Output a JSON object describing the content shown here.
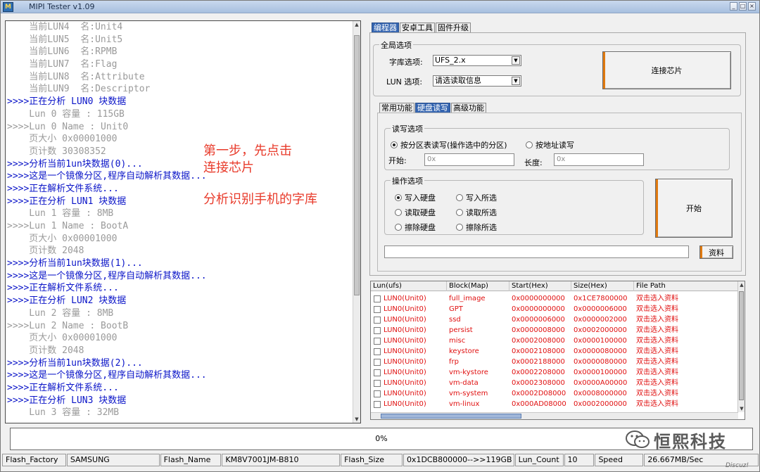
{
  "window": {
    "title": "MIPI Tester v1.09",
    "controls": {
      "minimize": "_",
      "maximize": "□",
      "close": "×"
    }
  },
  "log": [
    {
      "text": "    当前LUN4  名:Unit4",
      "color": "gray"
    },
    {
      "text": "    当前LUN5  名:Unit5",
      "color": "gray"
    },
    {
      "text": "    当前LUN6  名:RPMB",
      "color": "gray"
    },
    {
      "text": "    当前LUN7  名:Flag",
      "color": "gray"
    },
    {
      "text": "    当前LUN8  名:Attribute",
      "color": "gray"
    },
    {
      "text": "    当前LUN9  名:Descriptor",
      "color": "gray"
    },
    {
      "text": ">>>>正在分析 LUN0 块数据",
      "color": "blue"
    },
    {
      "text": "    Lun 0 容量 : 115GB",
      "color": "gray"
    },
    {
      "text": ">>>>Lun 0 Name : Unit0",
      "color": "gray"
    },
    {
      "text": "    页大小 0x00001000",
      "color": "gray"
    },
    {
      "text": "    页计数 30308352",
      "color": "gray"
    },
    {
      "text": ">>>>分析当前1un块数据(0)...",
      "color": "blue"
    },
    {
      "text": ">>>>这是一个镜像分区,程序自动解析其数据...",
      "color": "blue"
    },
    {
      "text": ">>>>正在解析文件系统...",
      "color": "blue"
    },
    {
      "text": ">>>>正在分析 LUN1 块数据",
      "color": "blue"
    },
    {
      "text": "    Lun 1 容量 : 8MB",
      "color": "gray"
    },
    {
      "text": ">>>>Lun 1 Name : BootA",
      "color": "gray"
    },
    {
      "text": "    页大小 0x00001000",
      "color": "gray"
    },
    {
      "text": "    页计数 2048",
      "color": "gray"
    },
    {
      "text": ">>>>分析当前1un块数据(1)...",
      "color": "blue"
    },
    {
      "text": ">>>>这是一个镜像分区,程序自动解析其数据...",
      "color": "blue"
    },
    {
      "text": ">>>>正在解析文件系统...",
      "color": "blue"
    },
    {
      "text": ">>>>正在分析 LUN2 块数据",
      "color": "blue"
    },
    {
      "text": "    Lun 2 容量 : 8MB",
      "color": "gray"
    },
    {
      "text": ">>>>Lun 2 Name : BootB",
      "color": "gray"
    },
    {
      "text": "    页大小 0x00001000",
      "color": "gray"
    },
    {
      "text": "    页计数 2048",
      "color": "gray"
    },
    {
      "text": ">>>>分析当前1un块数据(2)...",
      "color": "blue"
    },
    {
      "text": ">>>>这是一个镜像分区,程序自动解析其数据...",
      "color": "blue"
    },
    {
      "text": ">>>>正在解析文件系统...",
      "color": "blue"
    },
    {
      "text": ">>>>正在分析 LUN3 块数据",
      "color": "blue"
    },
    {
      "text": "    Lun 3 容量 : 32MB",
      "color": "gray"
    }
  ],
  "annotations": {
    "step1_line1": "第一步，先点击",
    "step1_line2": "连接芯片",
    "step2": "分析识别手机的字库"
  },
  "main_tabs": [
    "编程器",
    "安卓工具",
    "固件升级"
  ],
  "global": {
    "group_title": "全局选项",
    "library_label": "字库选项:",
    "library_value": "UFS_2.x",
    "lun_label": "LUN 选项:",
    "lun_value": "请选读取信息",
    "connect_button": "连接芯片"
  },
  "sub_tabs": [
    "常用功能",
    "硬盘读写",
    "高级功能"
  ],
  "rw": {
    "group_title": "读写选项",
    "radio_partition": "按分区表读写(操作选中的分区)",
    "radio_address": "按地址读写",
    "start_label": "开始:",
    "start_placeholder": "0x",
    "length_label": "长度:",
    "length_placeholder": "0x"
  },
  "ops": {
    "group_title": "操作选项",
    "write_disk": "写入硬盘",
    "write_selected": "写入所选",
    "read_disk": "读取硬盘",
    "read_selected": "读取所选",
    "erase_disk": "擦除硬盘",
    "erase_selected": "擦除所选",
    "start_button": "开始"
  },
  "path": {
    "value": "",
    "browse_button": "资料"
  },
  "table": {
    "headers": [
      "Lun(ufs)",
      "Block(Map)",
      "Start(Hex)",
      "Size(Hex)",
      "File Path"
    ],
    "rows": [
      [
        "LUN0(Unit0)",
        "full_image",
        "0x0000000000",
        "0x1CE7800000",
        "双击选入资料"
      ],
      [
        "LUN0(Unit0)",
        "GPT",
        "0x0000000000",
        "0x0000006000",
        "双击选入资料"
      ],
      [
        "LUN0(Unit0)",
        "ssd",
        "0x0000006000",
        "0x0000002000",
        "双击选入资料"
      ],
      [
        "LUN0(Unit0)",
        "persist",
        "0x0000008000",
        "0x0002000000",
        "双击选入资料"
      ],
      [
        "LUN0(Unit0)",
        "misc",
        "0x0002008000",
        "0x0000100000",
        "双击选入资料"
      ],
      [
        "LUN0(Unit0)",
        "keystore",
        "0x0002108000",
        "0x0000080000",
        "双击选入资料"
      ],
      [
        "LUN0(Unit0)",
        "frp",
        "0x0002188000",
        "0x0000080000",
        "双击选入资料"
      ],
      [
        "LUN0(Unit0)",
        "vm-kystore",
        "0x0002208000",
        "0x0000100000",
        "双击选入资料"
      ],
      [
        "LUN0(Unit0)",
        "vm-data",
        "0x0002308000",
        "0x0000A00000",
        "双击选入资料"
      ],
      [
        "LUN0(Unit0)",
        "vm-system",
        "0x0002D08000",
        "0x0008000000",
        "双击选入资料"
      ],
      [
        "LUN0(Unit0)",
        "vm-linux",
        "0x000AD08000",
        "0x0002000000",
        "双击选入资料"
      ]
    ]
  },
  "progress": {
    "text": "0%",
    "value": 0
  },
  "status": {
    "flash_factory_label": "Flash_Factory",
    "flash_factory_value": "SAMSUNG",
    "flash_name_label": "Flash_Name",
    "flash_name_value": "KM8V7001JM-B810",
    "flash_size_label": "Flash_Size",
    "flash_size_value": "0x1DCB800000-->>119GB",
    "lun_count_label": "Lun_Count",
    "lun_count_value": "10",
    "speed_label": "Speed",
    "speed_value": "26.667MB/Sec"
  },
  "watermark": {
    "text": "恒熙科技",
    "small": "Discuz!"
  },
  "colors": {
    "log_blue": "#0a14c8",
    "log_gray": "#9a9a9a",
    "annotation_red": "#e83a2a",
    "table_red": "#e01010",
    "tab_active": "#3565b0",
    "button_accent": "#e07a10"
  }
}
